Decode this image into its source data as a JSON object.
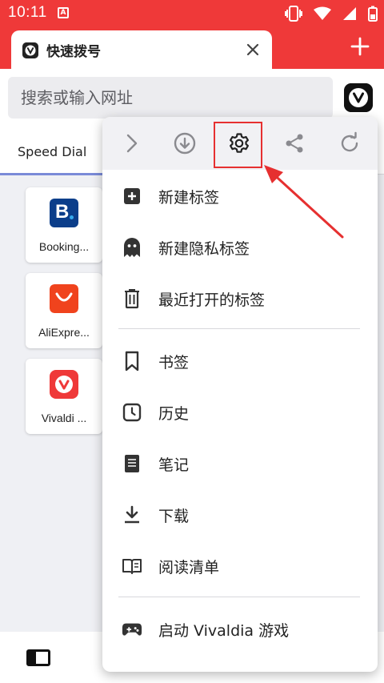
{
  "status": {
    "time": "10:11",
    "notification_badge": "A"
  },
  "tab": {
    "title": "快速拨号"
  },
  "address": {
    "placeholder": "搜索或输入网址"
  },
  "speed_dial_tab": {
    "label": "Speed Dial"
  },
  "tiles": [
    {
      "label": "Booking...",
      "logo_text": "B",
      "color": "#0b3e8a",
      "icon": "booking-logo"
    },
    {
      "label": "AliExpre...",
      "color": "#f0431d",
      "icon": "aliexpress-logo"
    },
    {
      "label": "Vivaldi ...",
      "color": "#ef3939",
      "icon": "vivaldi-logo"
    }
  ],
  "menu": {
    "toolbar": [
      "forward-icon",
      "download-icon",
      "settings-icon",
      "share-icon",
      "reload-icon"
    ],
    "items": [
      {
        "label": "新建标签",
        "icon": "new-tab-icon"
      },
      {
        "label": "新建隐私标签",
        "icon": "ghost-icon"
      },
      {
        "label": "最近打开的标签",
        "icon": "trash-icon"
      },
      {
        "label": "书签",
        "icon": "bookmark-icon"
      },
      {
        "label": "历史",
        "icon": "history-clock-icon"
      },
      {
        "label": "笔记",
        "icon": "notes-icon"
      },
      {
        "label": "下载",
        "icon": "download-icon"
      },
      {
        "label": "阅读清单",
        "icon": "book-icon"
      },
      {
        "label": "启动 Vivaldia 游戏",
        "icon": "gamepad-icon"
      }
    ]
  },
  "colors": {
    "brand_red": "#ef3939",
    "annotation_red": "#e63030",
    "tab_accent": "#7a8ad8"
  }
}
